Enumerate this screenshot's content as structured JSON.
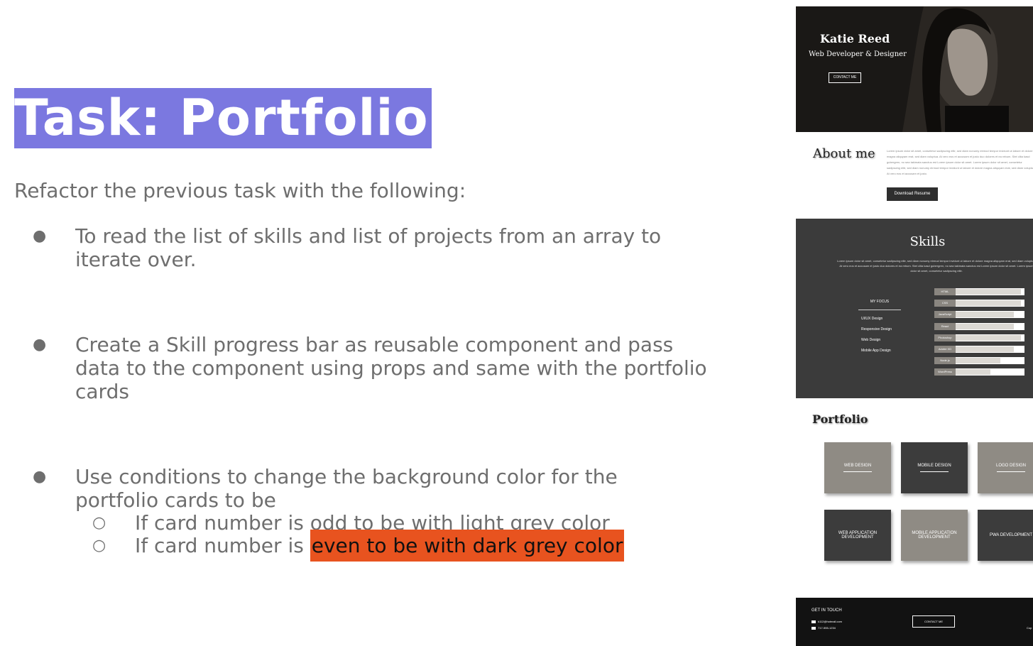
{
  "slide": {
    "title": "Task: Portfolio",
    "intro": "Refactor the previous task with the following:",
    "bullets": [
      {
        "line1": "To read the list of skills and list of projects from an array to",
        "line2": "iterate over."
      },
      {
        "line1": "Create a Skill progress bar as reusable component and pass",
        "line2": "data to the component using props and same with the portfolio",
        "line3": "cards"
      },
      {
        "line1": "Use conditions to change the background color for the",
        "line2": "portfolio cards to be"
      }
    ],
    "subbullets": [
      {
        "text": "If card number is odd to be with light grey color"
      },
      {
        "prefix": "If card number is ",
        "highlight": "even to be with dark grey color"
      }
    ],
    "bullet_glyph": "●",
    "sub_glyph": "○",
    "colors": {
      "title_bg": "#7b78e0",
      "highlight_bg": "#e8531f",
      "text": "#6e6e6e"
    }
  },
  "preview": {
    "hero": {
      "name": "Katie Reed",
      "role": "Web Developer & Designer",
      "button": "CONTACT ME"
    },
    "about": {
      "title": "About me",
      "text": "Lorem ipsum dolor sit amet, consetetur sadipscing elitr, sed diam nonumy eirmod tempor invidunt ut labore et dolore magna aliquyam erat, sed diam voluptua. At vero eos et accusam et justo duo dolores et ea rebum. Stet clita kasd gubergren, no sea takimata sanctus est Lorem ipsum dolor sit amet. Lorem ipsum dolor sit amet, consetetur sadipscing elitr, sed diam nonumy eirmod tempor invidunt ut labore et dolore magna aliquyam erat, sed diam voluptua. At vero eos et accusam et justo.",
      "button": "Download Resume"
    },
    "skills": {
      "title": "Skills",
      "text": "Lorem ipsum dolor sit amet, consetetur sadipscing elitr, sed diam nonumy eirmod tempor invidunt ut labore et dolore magna aliquyam erat, sed diam voluptua. At vero eos et accusam et justo duo dolores et ea rebum. Stet clita kasd gubergren, no sea takimata sanctus est Lorem ipsum dolor sit amet. Lorem ipsum dolor sit amet, consetetur sadipscing elitr.",
      "focus_title": "MY FOCUS",
      "focus_items": [
        "UI/UX Design",
        "Responsive Design",
        "Web Design",
        "Mobile App Design"
      ],
      "bars": [
        {
          "label": "HTML",
          "level": 0.95
        },
        {
          "label": "CSS",
          "level": 0.95
        },
        {
          "label": "JavaScript",
          "level": 0.85
        },
        {
          "label": "React",
          "level": 0.85
        },
        {
          "label": "Photoshop",
          "level": 0.95
        },
        {
          "label": "Adobe XD",
          "level": 0.85
        },
        {
          "label": "Node.js",
          "level": 0.65
        },
        {
          "label": "WordPress",
          "level": 0.5
        }
      ]
    },
    "portfolio": {
      "title": "Portfolio",
      "cards": [
        {
          "label": "WEB DESIGN",
          "shade": "light"
        },
        {
          "label": "MOBILE DESIGN",
          "shade": "dark"
        },
        {
          "label": "LOGO DESIGN",
          "shade": "light"
        },
        {
          "label": "WEB APPLICATION DEVELOPMENT",
          "shade": "dark"
        },
        {
          "label": "MOBILE APPLICATION DEVELOPMENT",
          "shade": "light"
        },
        {
          "label": "PWA DEVELOPMENT",
          "shade": "dark"
        }
      ]
    },
    "footer": {
      "title": "GET IN TOUCH",
      "email": "k112@hotmail.com",
      "phone": "717-555-1234",
      "button": "CONTACT ME",
      "copyright": "Cop"
    }
  }
}
